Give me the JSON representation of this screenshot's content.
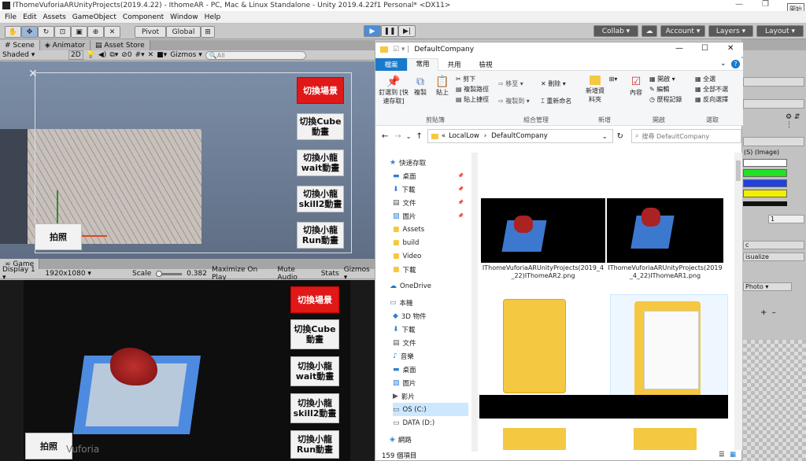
{
  "title": "IThomeVuforiaARUnityProjects(2019.4.22) - IthomeAR - PC, Mac & Linux Standalone - Unity 2019.4.22f1 Personal* <DX11>",
  "corner_label": "開始",
  "menu": [
    "File",
    "Edit",
    "Assets",
    "GameObject",
    "Component",
    "Window",
    "Help"
  ],
  "toolbar": {
    "pivot": "Pivot",
    "global": "Global",
    "collab": "Collab",
    "account": "Account",
    "layers": "Layers",
    "layout": "Layout"
  },
  "scene_tabs": [
    "Scene",
    "Animator",
    "Asset Store"
  ],
  "scene_bar": {
    "shading": "Shaded",
    "mode": "2D",
    "count": "0",
    "gizmos": "Gizmos",
    "search_placeholder": "All"
  },
  "scene_buttons": [
    "切換場景",
    "切換Cube\n動畫",
    "切換小龍\nwait動畫",
    "切換小龍\nskill2動畫",
    "切換小龍\nRun動畫"
  ],
  "scene_photo": "拍照",
  "game_tab": "Game",
  "game_bar": {
    "display": "Display 1",
    "resolution": "1920x1080",
    "scale_label": "Scale",
    "scale_value": "0.382",
    "maximize": "Maximize On Play",
    "mute": "Mute Audio",
    "stats": "Stats",
    "gizmos": "Gizmos"
  },
  "game_buttons": [
    "切換場景",
    "切換Cube\n動畫",
    "切換小龍\nwait動畫",
    "切換小龍\nskill2動畫",
    "切換小龍\nRun動畫"
  ],
  "game_photo": "拍照",
  "game_watermark": "Vuforia",
  "explorer": {
    "title": "DefaultCompany",
    "ribbon_tabs": [
      "檔案",
      "常用",
      "共用",
      "檢視"
    ],
    "ribbon": {
      "pin": "釘選到 [快速存取]",
      "copy": "複製",
      "paste": "貼上",
      "cut": "剪下",
      "copy_path": "複製路徑",
      "paste_shortcut": "貼上捷徑",
      "move_to": "移至",
      "copy_to": "複製到",
      "delete": "刪除",
      "rename": "重新命名",
      "new_folder": "新增資料夾",
      "properties": "內容",
      "open": "開啟",
      "edit": "編輯",
      "history": "歷程記錄",
      "select_all": "全選",
      "select_none": "全部不選",
      "invert": "反向選擇",
      "groups": [
        "剪貼簿",
        "組合管理",
        "新增",
        "開啟",
        "選取"
      ]
    },
    "path": [
      "LocalLow",
      "DefaultCompany"
    ],
    "search_placeholder": "搜尋 DefaultCompany",
    "nav": [
      {
        "label": "快速存取",
        "icon": "star-icon"
      },
      {
        "label": "桌面",
        "icon": "desktop-icon"
      },
      {
        "label": "下載",
        "icon": "download-icon"
      },
      {
        "label": "文件",
        "icon": "document-icon"
      },
      {
        "label": "圖片",
        "icon": "picture-icon"
      },
      {
        "label": "Assets",
        "icon": "folder-icon"
      },
      {
        "label": "build",
        "icon": "folder-icon"
      },
      {
        "label": "Video",
        "icon": "folder-icon"
      },
      {
        "label": "下載",
        "icon": "folder-icon"
      },
      {
        "label": "OneDrive",
        "icon": "cloud-icon"
      },
      {
        "label": "本機",
        "icon": "pc-icon"
      },
      {
        "label": "3D 物件",
        "icon": "3d-icon"
      },
      {
        "label": "下載",
        "icon": "download-icon"
      },
      {
        "label": "文件",
        "icon": "document-icon"
      },
      {
        "label": "音樂",
        "icon": "music-icon"
      },
      {
        "label": "桌面",
        "icon": "desktop-icon"
      },
      {
        "label": "圖片",
        "icon": "picture-icon"
      },
      {
        "label": "影片",
        "icon": "video-icon"
      },
      {
        "label": "OS (C:)",
        "icon": "drive-icon"
      },
      {
        "label": "DATA (D:)",
        "icon": "drive-icon"
      },
      {
        "label": "網路",
        "icon": "network-icon"
      }
    ],
    "files": [
      {
        "name": "IThomeVuforiaARUnityProjects(2019_4_22)IThomeAR2.png"
      },
      {
        "name": "IThomeVuforiaARUnityProjects(2019_4_22)IThomeAR1.png"
      }
    ],
    "status": "159 個項目"
  },
  "inspector": {
    "image_label": "(S) (Image)",
    "value": "1",
    "field1": "c",
    "field2": "isualize",
    "photo_dropdown": "Photo"
  },
  "colors": {
    "unity_bg": "#c2c2c2",
    "red_button": "#e01818",
    "explorer_accent": "#1979ca",
    "folder": "#f5c842"
  }
}
